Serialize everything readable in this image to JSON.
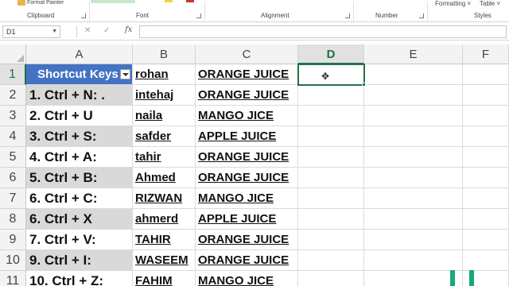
{
  "ribbon": {
    "format_painter": "Format Painter",
    "groups": {
      "clipboard": "Clipboard",
      "font": "Font",
      "alignment": "Alignment",
      "number": "Number",
      "styles": "Styles"
    },
    "top_right": {
      "formatting": "Formatting ˅",
      "table": "Table ˅"
    }
  },
  "formula_bar": {
    "name_box": "D1",
    "cancel": "✕",
    "enter": "✓",
    "fx": "fx",
    "content": ""
  },
  "columns": [
    "A",
    "B",
    "C",
    "D",
    "E",
    "F"
  ],
  "selected_column": "D",
  "selected_row": 1,
  "rows": [
    {
      "num": "1",
      "a": "Shortcut Keys",
      "b": "rohan",
      "c": "ORANGE JUICE"
    },
    {
      "num": "2",
      "a": "1. Ctrl + N: .",
      "b": "intehaj",
      "c": "ORANGE JUICE"
    },
    {
      "num": "3",
      "a": "2. Ctrl + U",
      "b": "naila",
      "c": "MANGO JICE"
    },
    {
      "num": "4",
      "a": "3. Ctrl + S:",
      "b": "safder",
      "c": "APPLE JUICE"
    },
    {
      "num": "5",
      "a": "4. Ctrl + A:",
      "b": "tahir",
      "c": "ORANGE JUICE"
    },
    {
      "num": "6",
      "a": "5. Ctrl + B:",
      "b": "Ahmed",
      "c": "ORANGE JUICE"
    },
    {
      "num": "7",
      "a": "6. Ctrl + C:",
      "b": "RIZWAN",
      "c": "MANGO JICE"
    },
    {
      "num": "8",
      "a": "6. Ctrl + X",
      "b": "ahmerd",
      "c": "APPLE JUICE"
    },
    {
      "num": "9",
      "a": "7. Ctrl + V:",
      "b": "TAHIR",
      "c": "ORANGE JUICE"
    },
    {
      "num": "10",
      "a": "9. Ctrl + I:",
      "b": "WASEEM",
      "c": "ORANGE JUICE"
    },
    {
      "num": "11",
      "a": "10. Ctrl + Z:",
      "b": "FAHIM",
      "c": "MANGO JICE"
    }
  ],
  "colors": {
    "header_fill": "#4472c4",
    "stripe_fill": "#d9d9d9",
    "selection": "#217346"
  },
  "icons": [
    "format-painter-icon",
    "filter-dropdown-icon",
    "cell-cursor-icon",
    "name-box-dropdown-icon"
  ]
}
